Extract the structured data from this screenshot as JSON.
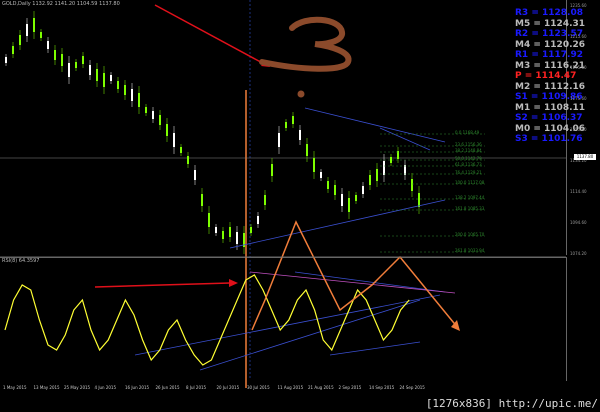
{
  "header": {
    "symbol_line": "GOLD,Daily  1132.92 1141.20 1104.59 1137.80",
    "rsi_line": "RSI(8) 64.3597"
  },
  "pivots": [
    {
      "label": "R3 = 1128.08",
      "color": "#1a1aff"
    },
    {
      "label": "M5 = 1124.31",
      "color": "#bbbbbb"
    },
    {
      "label": "R2 = 1123.57",
      "color": "#1a1aff"
    },
    {
      "label": "M4 = 1120.26",
      "color": "#bbbbbb"
    },
    {
      "label": "R1 = 1117.92",
      "color": "#1a1aff"
    },
    {
      "label": "M3 = 1116.21",
      "color": "#bbbbbb"
    },
    {
      "label": "P  = 1114.47",
      "color": "#ff2222"
    },
    {
      "label": "M2 = 1112.16",
      "color": "#bbbbbb"
    },
    {
      "label": "S1 = 1109.86",
      "color": "#1a1aff"
    },
    {
      "label": "M1 = 1108.11",
      "color": "#bbbbbb"
    },
    {
      "label": "S2 = 1106.37",
      "color": "#1a1aff"
    },
    {
      "label": "M0 = 1104.06",
      "color": "#bbbbbb"
    },
    {
      "label": "S3 = 1101.76",
      "color": "#1a1aff"
    }
  ],
  "price_axis": [
    "1235.60",
    "1215.60",
    "1195.80",
    "1175.60",
    "1155.80",
    "1134.20",
    "1114.40",
    "1094.60",
    "1074.20"
  ],
  "current_price": "1137.80",
  "date_axis": [
    "1 May 2015",
    "13 May 2015",
    "25 May 2015",
    "4 Jun 2015",
    "16 Jun 2015",
    "26 Jun 2015",
    "8 Jul 2015",
    "20 Jul 2015",
    "30 Jul 2015",
    "11 Aug 2015",
    "21 Aug 2015",
    "2 Sep 2015",
    "14 Sep 2015",
    "24 Sep 2015"
  ],
  "fib_labels": [
    "0.0 1168.49",
    "23.6 1156.36",
    "38.2 1148.84",
    "50.0 1142.79",
    "61.8 1136.73",
    "76.4 1129.21",
    "100.0 1117.08",
    "138.2 1097.44",
    "161.8 1085.33",
    "200.0 1065.70",
    "261.8 1033.94"
  ],
  "annotation_digit": "3",
  "watermark": "[1276x836] http://upic.me/",
  "colors": {
    "background": "#000000",
    "bull_candle": "#7fff00",
    "bear_candle": "#ffffff",
    "rsi_line": "#ffff33",
    "trendline_blue": "#3a4fd0",
    "arrow_red": "#e0101a",
    "drawing_orange": "#f07d3a",
    "drawing_brown": "#8b4a2b"
  }
}
